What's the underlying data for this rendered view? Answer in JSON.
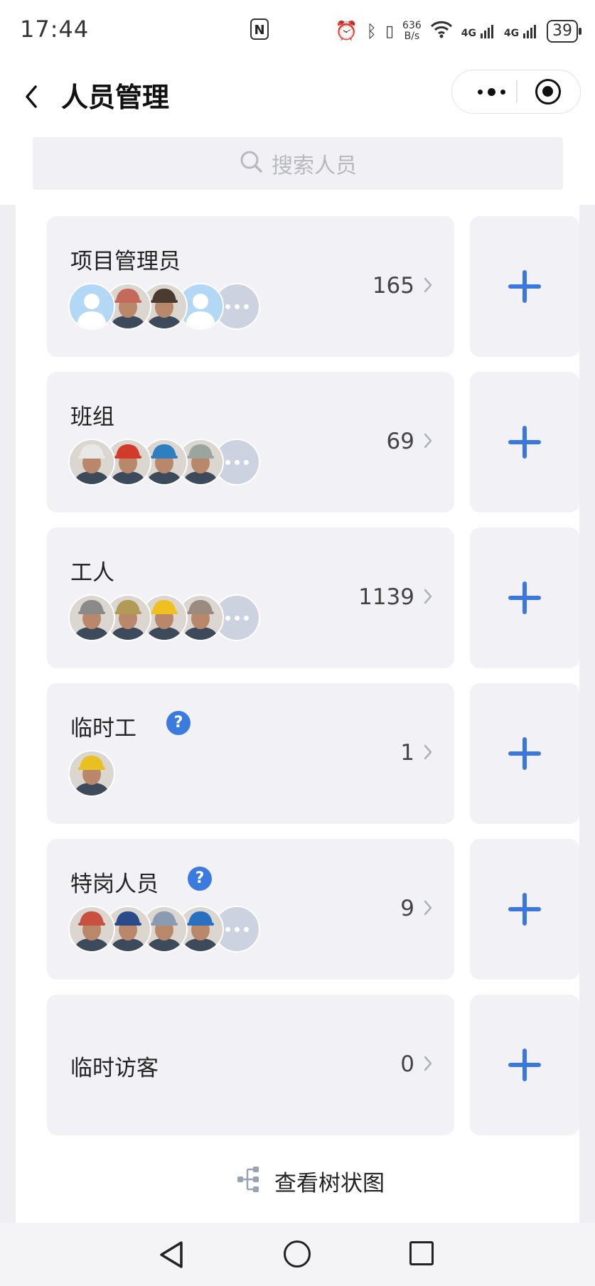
{
  "status_bar": {
    "time": "17:44",
    "net_speed_value": "636",
    "net_speed_unit": "B/s",
    "signal1": "4G",
    "signal2": "4G",
    "battery": "39",
    "nfc": "N"
  },
  "header": {
    "title": "人员管理"
  },
  "search": {
    "placeholder": "搜索人员"
  },
  "groups": [
    {
      "name": "项目管理员",
      "count": "165",
      "has_help": false,
      "avatars": [
        "default",
        "#c46a5a",
        "#4a3a30",
        "default"
      ],
      "has_more": true
    },
    {
      "name": "班组",
      "count": "69",
      "has_help": false,
      "avatars": [
        "#e8e8e8",
        "#d23a2a",
        "#2e7fc0",
        "#9aa5a0"
      ],
      "has_more": true
    },
    {
      "name": "工人",
      "count": "1139",
      "has_help": false,
      "avatars": [
        "#8a8a8a",
        "#b09a55",
        "#f0c020",
        "#9a8a80"
      ],
      "has_more": true
    },
    {
      "name": "临时工",
      "count": "1",
      "has_help": true,
      "avatars": [
        "#e8c020"
      ],
      "has_more": false
    },
    {
      "name": "特岗人员",
      "count": "9",
      "has_help": true,
      "avatars": [
        "#c85040",
        "#2a4a8a",
        "#8a9ab0",
        "#2a70c0"
      ],
      "has_more": true
    },
    {
      "name": "临时访客",
      "count": "0",
      "has_help": false,
      "avatars": [],
      "has_more": false
    }
  ],
  "help_symbol": "?",
  "tree_link": {
    "label": "查看树状图"
  },
  "colors": {
    "accent": "#3a78e0",
    "card_bg": "#f1f1f6",
    "page_bg": "#eeeef3"
  }
}
